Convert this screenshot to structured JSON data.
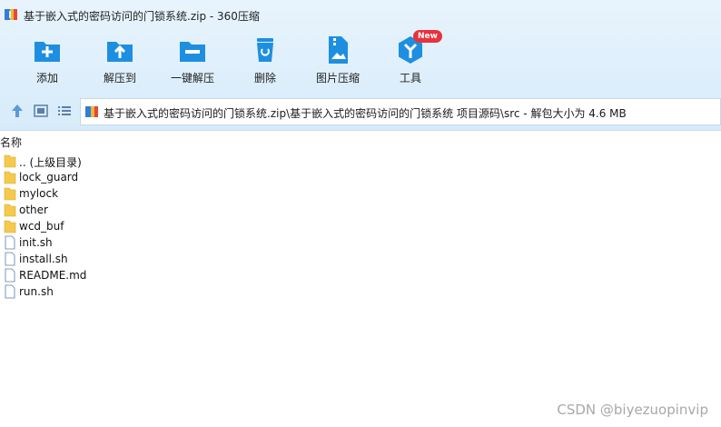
{
  "window": {
    "title": "基于嵌入式的密码访问的门锁系统.zip - 360压缩",
    "app_icon": "zip-archive-icon"
  },
  "toolbar": {
    "items": [
      {
        "label": "添加",
        "icon": "add-icon"
      },
      {
        "label": "解压到",
        "icon": "extract-to-icon"
      },
      {
        "label": "一键解压",
        "icon": "one-click-extract-icon"
      },
      {
        "label": "删除",
        "icon": "delete-icon"
      },
      {
        "label": "图片压缩",
        "icon": "image-compress-icon"
      },
      {
        "label": "工具",
        "icon": "tools-icon",
        "badge": "New"
      }
    ]
  },
  "navbar": {
    "path": "基于嵌入式的密码访问的门锁系统.zip\\基于嵌入式的密码访问的门锁系统 项目源码\\src - 解包大小为 4.6 MB"
  },
  "list": {
    "column_name": "名称",
    "items": [
      {
        "name": ".. (上级目录)",
        "type": "folder"
      },
      {
        "name": "lock_guard",
        "type": "folder"
      },
      {
        "name": "mylock",
        "type": "folder"
      },
      {
        "name": "other",
        "type": "folder"
      },
      {
        "name": "wcd_buf",
        "type": "folder"
      },
      {
        "name": "init.sh",
        "type": "file"
      },
      {
        "name": "install.sh",
        "type": "file"
      },
      {
        "name": "README.md",
        "type": "file"
      },
      {
        "name": "run.sh",
        "type": "file"
      }
    ]
  },
  "watermark": "CSDN @biyezuopinvip",
  "colors": {
    "accent": "#1e8fe0",
    "badge": "#e8323c",
    "folder": "#f5c94c"
  }
}
